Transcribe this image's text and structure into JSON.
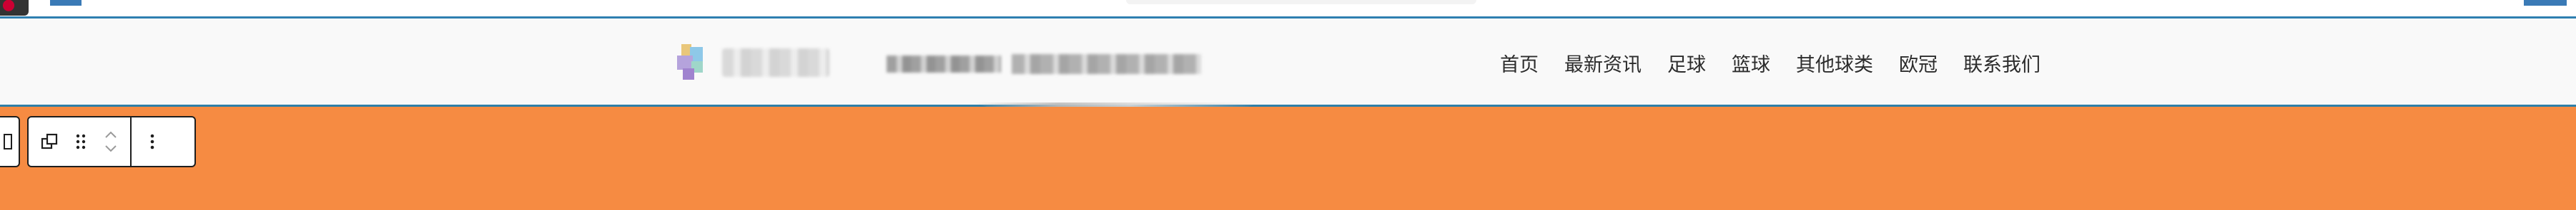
{
  "nav": {
    "items": [
      "首页",
      "最新资讯",
      "足球",
      "篮球",
      "其他球类",
      "欧冠",
      "联系我们"
    ]
  },
  "colors": {
    "header_bg": "#f9f9f9",
    "header_border": "#2f7fa8",
    "content_bg": "#f68b42",
    "toolbar_border": "#1e1e1e",
    "nav_text": "#2c2c2c"
  },
  "toolbar": {
    "icons": [
      "block-type-stub-icon",
      "transform-block-icon",
      "drag-handle-icon",
      "move-up-icon",
      "move-down-icon",
      "more-options-icon"
    ]
  }
}
